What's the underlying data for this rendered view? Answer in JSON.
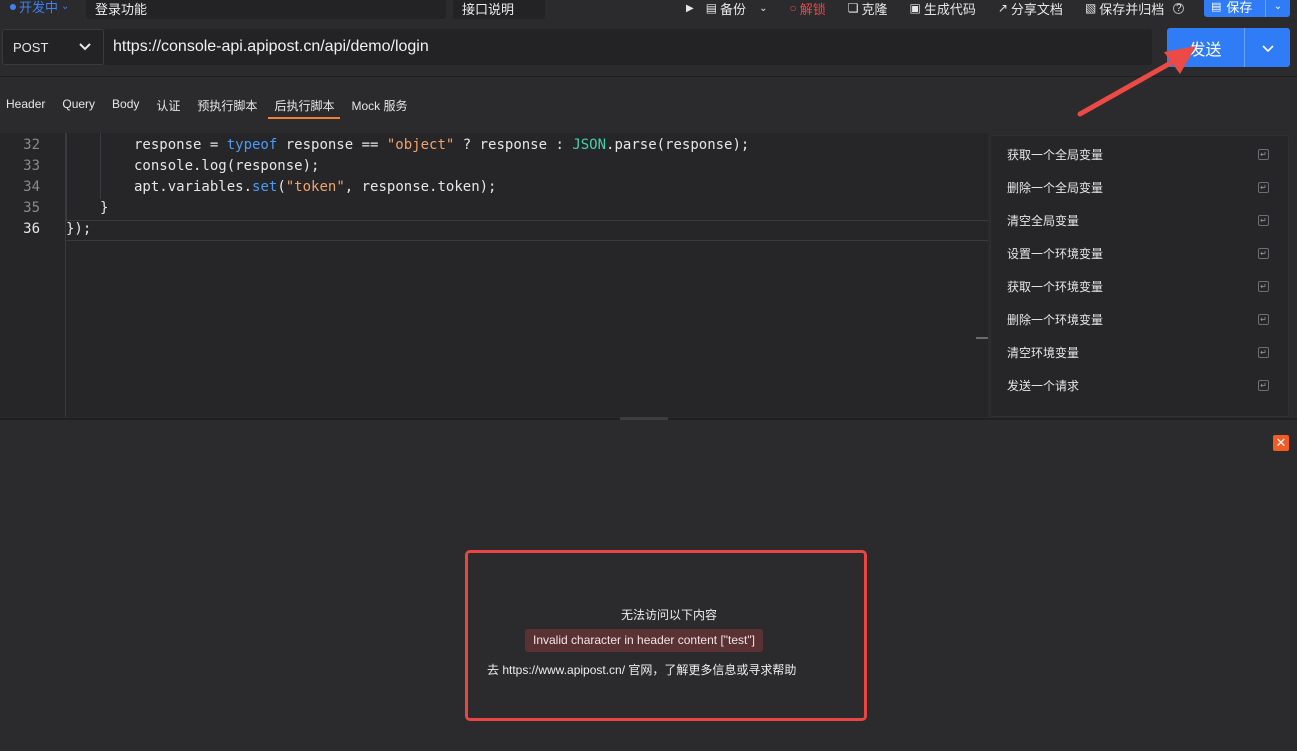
{
  "toolbar": {
    "environment": "开发中",
    "api_name": "登录功能",
    "api_desc_label": "接口说明",
    "actions": [
      {
        "label": "备份",
        "icon": "backup-icon"
      },
      {
        "label": "解锁",
        "icon": "lock-icon"
      },
      {
        "label": "克隆",
        "icon": "clone-icon"
      },
      {
        "label": "生成代码",
        "icon": "code-icon"
      },
      {
        "label": "分享文档",
        "icon": "share-icon"
      },
      {
        "label": "保存并归档",
        "icon": "archive-icon"
      }
    ],
    "save_label": "保存"
  },
  "request": {
    "method": "POST",
    "url": "https://console-api.apipost.cn/api/demo/login",
    "send_label": "发送"
  },
  "tabs": [
    {
      "label": "Header"
    },
    {
      "label": "Query"
    },
    {
      "label": "Body"
    },
    {
      "label": "认证"
    },
    {
      "label": "预执行脚本"
    },
    {
      "label": "后执行脚本",
      "active": true
    },
    {
      "label": "Mock 服务"
    }
  ],
  "editor": {
    "line_numbers": [
      "32",
      "33",
      "34",
      "35",
      "36"
    ],
    "current_line": "36"
  },
  "snippets": [
    "获取一个全局变量",
    "删除一个全局变量",
    "清空全局变量",
    "设置一个环境变量",
    "获取一个环境变量",
    "删除一个环境变量",
    "清空环境变量",
    "发送一个请求"
  ],
  "response": {
    "error_title": "无法访问以下内容",
    "error_message": "Invalid character in header content [\"test\"]",
    "help_text": "去 https://www.apipost.cn/ 官网，了解更多信息或寻求帮助"
  },
  "colors": {
    "accent": "#2f7cf6",
    "active_tab": "#f07f3c",
    "error_border": "#e84545",
    "annotation_arrow": "#ec4a44"
  }
}
